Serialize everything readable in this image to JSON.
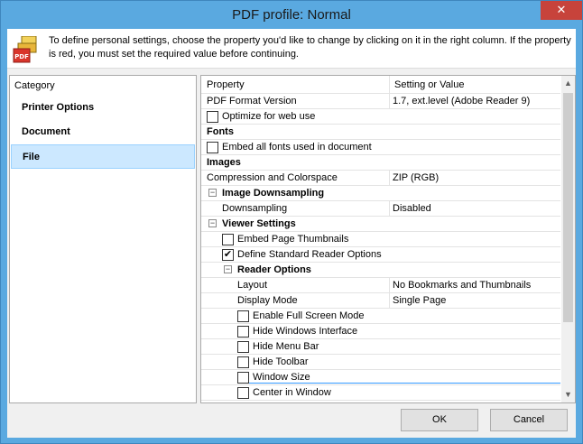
{
  "window": {
    "title": "PDF profile: Normal",
    "close_glyph": "✕"
  },
  "info": {
    "icon": "pdf-printer-icon",
    "text": "To define personal settings, choose the property you'd like to change by clicking on it in the right column. If the property is red, you must set the required value before continuing."
  },
  "category": {
    "header": "Category",
    "items": [
      {
        "label": "Printer Options",
        "selected": false
      },
      {
        "label": "Document",
        "selected": false
      },
      {
        "label": "File",
        "selected": true
      }
    ]
  },
  "properties": {
    "header_property": "Property",
    "header_value": "Setting or Value",
    "rows": [
      {
        "label": "PDF Format Version",
        "value": "1.7, ext.level (Adobe Reader 9)"
      },
      {
        "label": "Optimize for web use",
        "checked": false
      },
      {
        "label": "Fonts"
      },
      {
        "label": "Embed all fonts used in document",
        "checked": false
      },
      {
        "label": "Images"
      },
      {
        "label": "Compression and Colorspace",
        "value": "ZIP (RGB)"
      },
      {
        "label": "Image Downsampling",
        "expanded": true
      },
      {
        "label": "Downsampling",
        "value": "Disabled"
      },
      {
        "label": "Viewer Settings",
        "expanded": true
      },
      {
        "label": "Embed Page Thumbnails",
        "checked": false
      },
      {
        "label": "Define Standard Reader Options",
        "checked": true
      },
      {
        "label": "Reader Options",
        "expanded": true
      },
      {
        "label": "Layout",
        "value": "No Bookmarks and Thumbnails"
      },
      {
        "label": "Display Mode",
        "value": "Single Page"
      },
      {
        "label": "Enable Full Screen Mode",
        "checked": false
      },
      {
        "label": "Hide Windows Interface",
        "checked": false
      },
      {
        "label": "Hide Menu Bar",
        "checked": false
      },
      {
        "label": "Hide Toolbar",
        "checked": false
      },
      {
        "label": "Window Size",
        "checked": false
      },
      {
        "label": "Center in Window",
        "checked": false
      }
    ]
  },
  "scrollbar": {
    "up_glyph": "▲",
    "down_glyph": "▼"
  },
  "toggle": {
    "minus_glyph": "−"
  },
  "checkbox": {
    "check_glyph": "✔"
  },
  "buttons": {
    "ok": "OK",
    "cancel": "Cancel"
  }
}
